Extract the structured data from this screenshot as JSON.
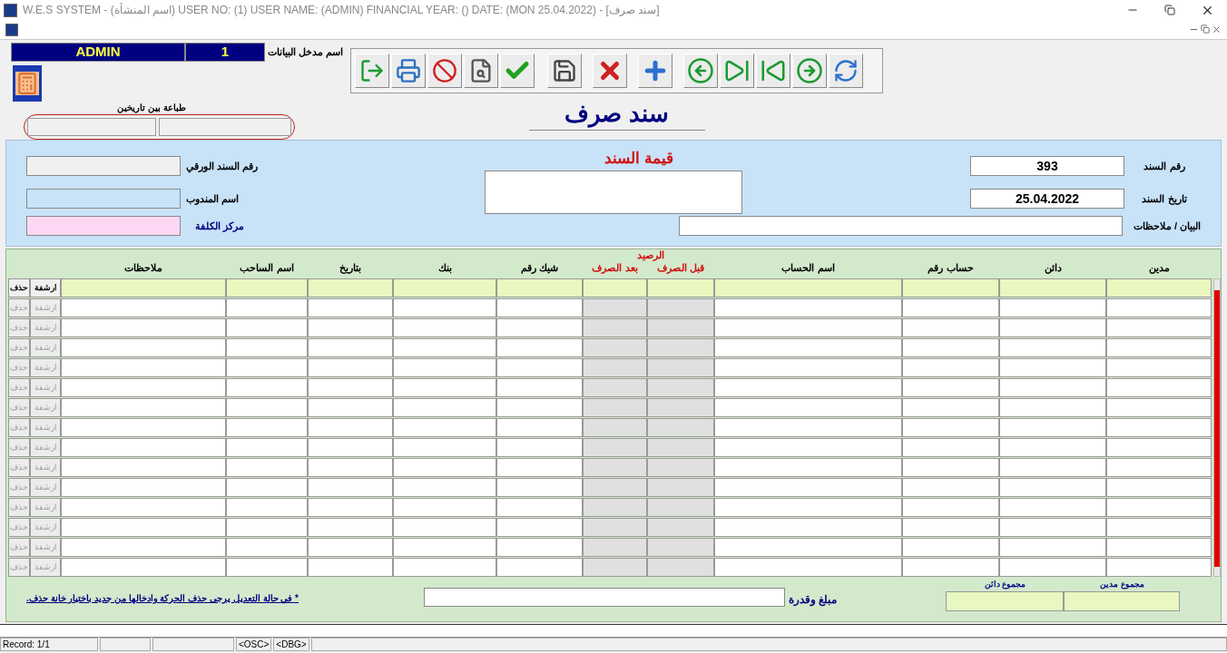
{
  "window": {
    "title": "W.E.S SYSTEM -  (اسم المنشأة)  USER NO: (1) USER NAME: (ADMIN) FINANCIAL YEAR: ()  DATE: (MON 25.04.2022) - [سند صرف]"
  },
  "user": {
    "label": "اسم مدخل البيانات",
    "name": "ADMIN",
    "number": "1"
  },
  "print_range": {
    "label": "طباعة بين تاريخين"
  },
  "form_title": "سند صرف",
  "header": {
    "voucher_number_label": "رقم السند",
    "voucher_number": "393",
    "voucher_date_label": "تاريخ السند",
    "voucher_date": "25.04.2022",
    "description_label": "البيان / ملاحظات",
    "amount_label": "قيمة السند",
    "paper_number_label": "رقم السند الورقي",
    "delegate_label": "اسم المندوب",
    "cost_center_label": "مركز الكلفة"
  },
  "grid": {
    "balance_group": "الرصيد",
    "columns": [
      {
        "label": "مدين",
        "kind": "text"
      },
      {
        "label": "دائن",
        "kind": "text"
      },
      {
        "label": "حساب رقم",
        "kind": "text"
      },
      {
        "label": "اسم الحساب",
        "kind": "text"
      },
      {
        "label": "قبل الصرف",
        "kind": "balance"
      },
      {
        "label": "بعد الصرف",
        "kind": "balance"
      },
      {
        "label": "شيك رقم",
        "kind": "text"
      },
      {
        "label": "بنك",
        "kind": "text"
      },
      {
        "label": "بتاريخ",
        "kind": "text"
      },
      {
        "label": "اسم الساحب",
        "kind": "text"
      },
      {
        "label": "ملاحظات",
        "kind": "text"
      }
    ],
    "rows": [
      {
        "selected": true,
        "delete": "حذف",
        "archive": "ارشفة"
      },
      {
        "selected": false,
        "delete": "حذف",
        "archive": "ارشفة"
      },
      {
        "selected": false,
        "delete": "حذف",
        "archive": "ارشفة"
      },
      {
        "selected": false,
        "delete": "حذف",
        "archive": "ارشفة"
      },
      {
        "selected": false,
        "delete": "حذف",
        "archive": "ارشفة"
      },
      {
        "selected": false,
        "delete": "حذف",
        "archive": "ارشفة"
      },
      {
        "selected": false,
        "delete": "حذف",
        "archive": "ارشفة"
      },
      {
        "selected": false,
        "delete": "حذف",
        "archive": "ارشفة"
      },
      {
        "selected": false,
        "delete": "حذف",
        "archive": "ارشفة"
      },
      {
        "selected": false,
        "delete": "حذف",
        "archive": "ارشفة"
      },
      {
        "selected": false,
        "delete": "حذف",
        "archive": "ارشفة"
      },
      {
        "selected": false,
        "delete": "حذف",
        "archive": "ارشفة"
      },
      {
        "selected": false,
        "delete": "حذف",
        "archive": "ارشفة"
      },
      {
        "selected": false,
        "delete": "حذف",
        "archive": "ارشفة"
      },
      {
        "selected": false,
        "delete": "حذف",
        "archive": "ارشفة"
      }
    ]
  },
  "footer": {
    "note": "* في حالة التعديل يرجى حذف الحركة وادخالها من جديد باختيار خانة حذف.",
    "amount_words_label": "مبلغ وقدرة",
    "total_credit_label": "مجموع دائن",
    "total_debit_label": "مجموع مدين"
  },
  "status_bar": {
    "record": "Record: 1/1",
    "osc": "<OSC>",
    "dbg": "<DBG>"
  }
}
